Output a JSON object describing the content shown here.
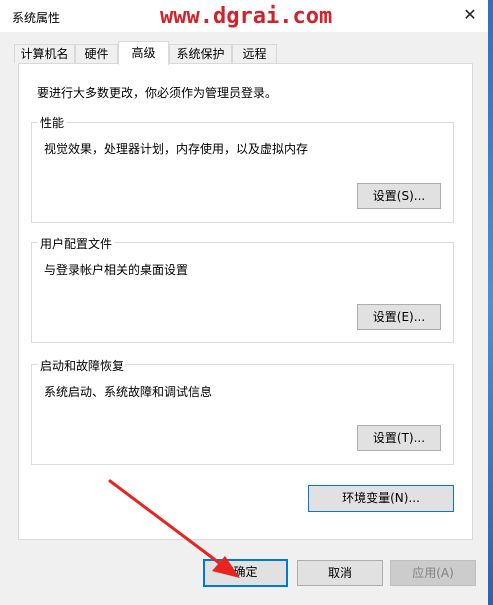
{
  "window": {
    "title": "系统属性",
    "close_glyph": "✕"
  },
  "watermark": "www.dgrai.com",
  "tabs": [
    {
      "label": "计算机名"
    },
    {
      "label": "硬件"
    },
    {
      "label": "高级",
      "active": true
    },
    {
      "label": "系统保护"
    },
    {
      "label": "远程"
    }
  ],
  "admin_note": "要进行大多数更改，你必须作为管理员登录。",
  "groups": {
    "performance": {
      "title": "性能",
      "desc": "视觉效果，处理器计划，内存使用，以及虚拟内存",
      "button": "设置(S)..."
    },
    "profiles": {
      "title": "用户配置文件",
      "desc": "与登录帐户相关的桌面设置",
      "button": "设置(E)..."
    },
    "startup": {
      "title": "启动和故障恢复",
      "desc": "系统启动、系统故障和调试信息",
      "button": "设置(T)..."
    }
  },
  "env_button": "环境变量(N)...",
  "footer": {
    "ok": "确定",
    "cancel": "取消",
    "apply": "应用(A)"
  },
  "colors": {
    "watermark": "#d2232a",
    "arrow": "#e8241f",
    "focus_border": "#0078d7"
  }
}
